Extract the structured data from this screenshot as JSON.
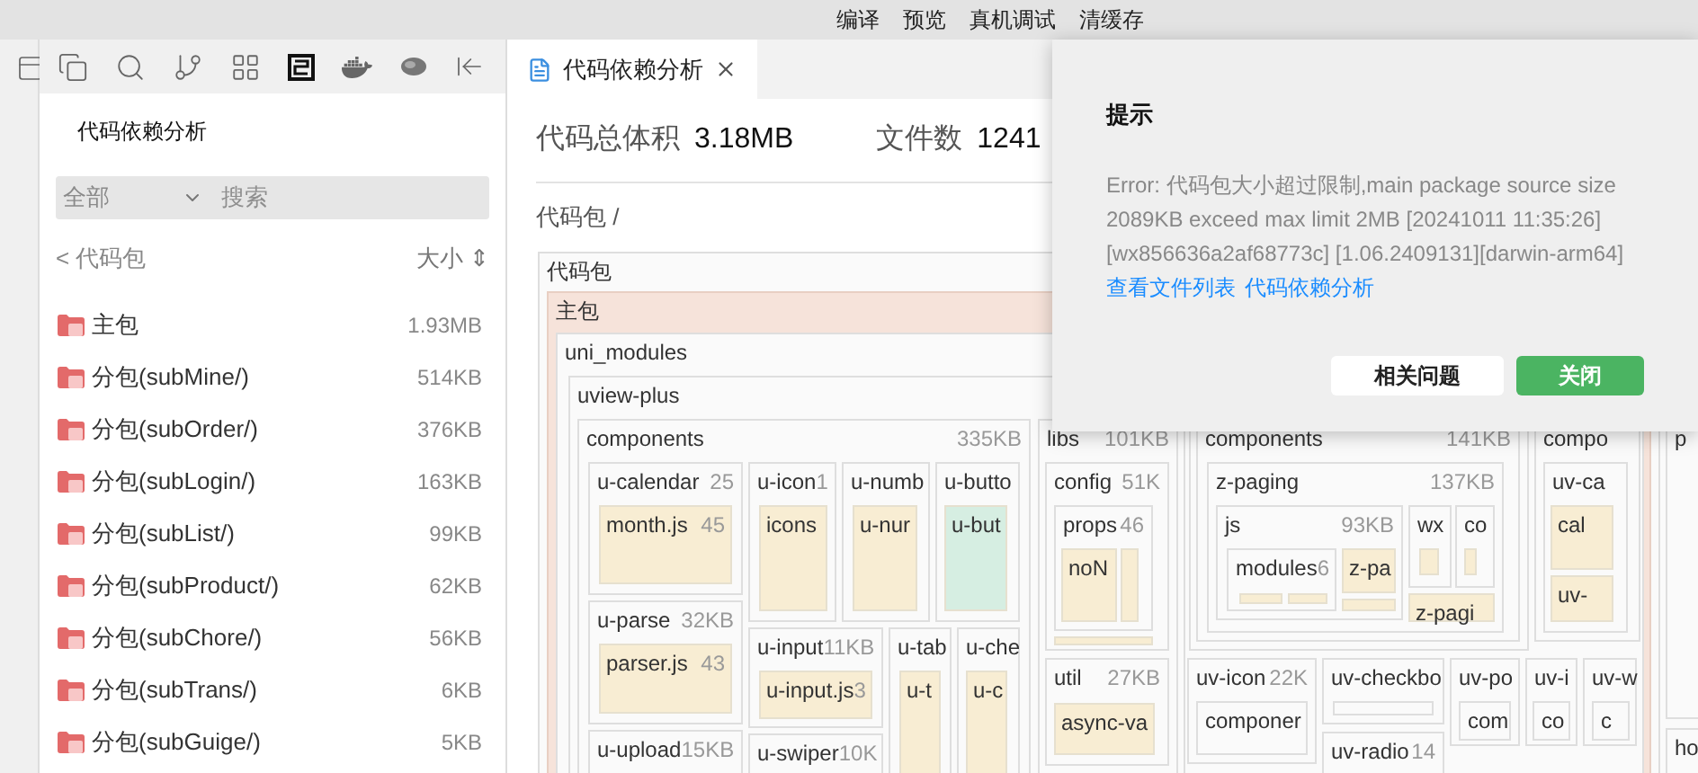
{
  "menu_bar": [
    "编译",
    "预览",
    "真机调试",
    "清缓存"
  ],
  "sidebar": {
    "title": "代码依赖分析",
    "filter": {
      "value": "全部",
      "placeholder": "搜索"
    },
    "header": {
      "back": "< 代码包",
      "sort": "大小 ⇕"
    },
    "items": [
      {
        "name": "主包",
        "size": "1.93MB"
      },
      {
        "name": "分包(subMine/)",
        "size": "514KB"
      },
      {
        "name": "分包(subOrder/)",
        "size": "376KB"
      },
      {
        "name": "分包(subLogin/)",
        "size": "163KB"
      },
      {
        "name": "分包(subList/)",
        "size": "99KB"
      },
      {
        "name": "分包(subProduct/)",
        "size": "62KB"
      },
      {
        "name": "分包(subChore/)",
        "size": "56KB"
      },
      {
        "name": "分包(subTrans/)",
        "size": "6KB"
      },
      {
        "name": "分包(subGuige/)",
        "size": "5KB"
      }
    ]
  },
  "tabs": [
    {
      "label": "代码依赖分析",
      "selected": true
    }
  ],
  "stats": [
    {
      "label": "代码总体积",
      "value": "3.18MB"
    },
    {
      "label": "文件数",
      "value": "1241"
    }
  ],
  "breadcrumb": "代码包 /",
  "treemap": {
    "kind": "folder",
    "label": "代码包",
    "children": [
      {
        "kind": "package",
        "label": "主包",
        "children": [
          {
            "kind": "folder",
            "label": "uni_modules",
            "children": [
              {
                "kind": "folder",
                "label": "uview-plus",
                "children": [
                  {
                    "kind": "folder",
                    "label": "components",
                    "size": "335KB",
                    "children": [
                      {
                        "kind": "folder",
                        "label": "u-calendar",
                        "size": "25",
                        "children": [
                          {
                            "kind": "file",
                            "label": "month.js",
                            "size": "45",
                            "color": "#f8edd3"
                          }
                        ]
                      },
                      {
                        "kind": "folder",
                        "label": "u-icon",
                        "size": "1",
                        "children": [
                          {
                            "kind": "file",
                            "label": "icons",
                            "color": "#f8edd3"
                          }
                        ]
                      },
                      {
                        "kind": "folder",
                        "label": "u-numb",
                        "children": [
                          {
                            "kind": "file",
                            "label": "u-nur",
                            "color": "#f8edd3"
                          }
                        ]
                      },
                      {
                        "kind": "folder",
                        "label": "u-butto",
                        "children": [
                          {
                            "kind": "file",
                            "label": "u-but",
                            "color": "#d6eee2"
                          }
                        ]
                      },
                      {
                        "kind": "folder",
                        "label": "u-parse",
                        "size": "32KB",
                        "children": [
                          {
                            "kind": "file",
                            "label": "parser.js",
                            "size": "43",
                            "color": "#f8edd3"
                          }
                        ]
                      },
                      {
                        "kind": "folder",
                        "label": "u-input",
                        "size": "11KB",
                        "children": [
                          {
                            "kind": "file",
                            "label": "u-input.js",
                            "size": "3",
                            "color": "#f8edd3"
                          }
                        ]
                      },
                      {
                        "kind": "folder",
                        "label": "u-tab",
                        "children": [
                          {
                            "kind": "file",
                            "label": "u-t",
                            "color": "#f8edd3"
                          }
                        ]
                      },
                      {
                        "kind": "folder",
                        "label": "u-che",
                        "children": [
                          {
                            "kind": "file",
                            "label": "u-c",
                            "color": "#f8edd3"
                          }
                        ]
                      },
                      {
                        "kind": "folder",
                        "label": "u-upload",
                        "size": "15KB"
                      },
                      {
                        "kind": "folder",
                        "label": "u-swiper",
                        "size": "10K"
                      }
                    ]
                  },
                  {
                    "kind": "folder",
                    "label": "libs",
                    "size": "101KB",
                    "children": [
                      {
                        "kind": "folder",
                        "label": "config",
                        "size": "51K",
                        "children": [
                          {
                            "kind": "folder",
                            "label": "props",
                            "size": "46",
                            "children": [
                              {
                                "kind": "file",
                                "label": "noN",
                                "color": "#f8edd3"
                              },
                              {
                                "kind": "file",
                                "color": "#f8edd3"
                              }
                            ]
                          },
                          {
                            "kind": "file",
                            "color": "#f8edd3"
                          }
                        ]
                      },
                      {
                        "kind": "folder",
                        "label": "util",
                        "size": "27KB",
                        "children": [
                          {
                            "kind": "file",
                            "label": "async-va",
                            "color": "#f8edd3"
                          }
                        ]
                      }
                    ]
                  }
                ]
              },
              {
                "kind": "folder",
                "children": [
                  {
                    "kind": "folder",
                    "children": [
                      {
                        "kind": "folder",
                        "label": "components",
                        "size": "141KB",
                        "children": [
                          {
                            "kind": "folder",
                            "label": "z-paging",
                            "size": "137KB",
                            "children": [
                              {
                                "kind": "folder",
                                "label": "js",
                                "size": "93KB",
                                "children": [
                                  {
                                    "kind": "folder",
                                    "label": "modules",
                                    "size": "6",
                                    "children": [
                                      {
                                        "kind": "file",
                                        "color": "#f8edd3"
                                      },
                                      {
                                        "kind": "file",
                                        "color": "#f8edd3"
                                      }
                                    ]
                                  },
                                  {
                                    "kind": "file",
                                    "label": "z-pa",
                                    "color": "#f8edd3"
                                  },
                                  {
                                    "kind": "file",
                                    "color": "#f8edd3"
                                  }
                                ]
                              },
                              {
                                "kind": "folder",
                                "label": "wx",
                                "children": [
                                  {
                                    "kind": "file",
                                    "color": "#f8edd3"
                                  }
                                ]
                              },
                              {
                                "kind": "folder",
                                "label": "co",
                                "children": [
                                  {
                                    "kind": "file",
                                    "color": "#f8edd3"
                                  }
                                ]
                              },
                              {
                                "kind": "file",
                                "label": "z-pagi",
                                "color": "#f8edd3"
                              }
                            ]
                          }
                        ]
                      }
                    ]
                  },
                  {
                    "kind": "folder",
                    "label": "compo",
                    "children": [
                      {
                        "kind": "folder",
                        "label": "uv-ca",
                        "children": [
                          {
                            "kind": "file",
                            "label": "cal",
                            "color": "#f8edd3"
                          },
                          {
                            "kind": "file",
                            "label": "uv-",
                            "color": "#f8edd3"
                          }
                        ]
                      }
                    ]
                  },
                  {
                    "kind": "folder",
                    "label": "uv-icon",
                    "size": "22K",
                    "children": [
                      {
                        "kind": "folder",
                        "label": "componer"
                      }
                    ]
                  },
                  {
                    "kind": "folder",
                    "label": "uv-checkbo",
                    "children": [
                      {
                        "kind": "folder"
                      }
                    ]
                  },
                  {
                    "kind": "folder",
                    "label": "uv-radio",
                    "size": "14"
                  },
                  {
                    "kind": "folder",
                    "label": "uv-po",
                    "children": [
                      {
                        "kind": "folder",
                        "label": "com"
                      }
                    ]
                  },
                  {
                    "kind": "folder",
                    "label": "uv-i",
                    "children": [
                      {
                        "kind": "folder",
                        "label": "co"
                      }
                    ]
                  },
                  {
                    "kind": "folder",
                    "label": "uv-w",
                    "children": [
                      {
                        "kind": "folder",
                        "label": "c"
                      }
                    ]
                  }
                ]
              }
            ]
          }
        ]
      },
      {
        "kind": "folder",
        "children": [
          {
            "kind": "folder",
            "label": "p"
          },
          {
            "kind": "folder",
            "label": "ho"
          }
        ]
      }
    ]
  },
  "dialog": {
    "title": "提示",
    "message": "Error: 代码包大小超过限制,main package source size 2089KB exceed max limit 2MB [20241011 11:35:26] [wx856636a2af68773c] [1.06.2409131][darwin-arm64]",
    "links": [
      "查看文件列表",
      "代码依赖分析"
    ],
    "buttons": [
      {
        "label": "相关问题",
        "kind": "secondary"
      },
      {
        "label": "关闭",
        "kind": "primary"
      }
    ]
  }
}
